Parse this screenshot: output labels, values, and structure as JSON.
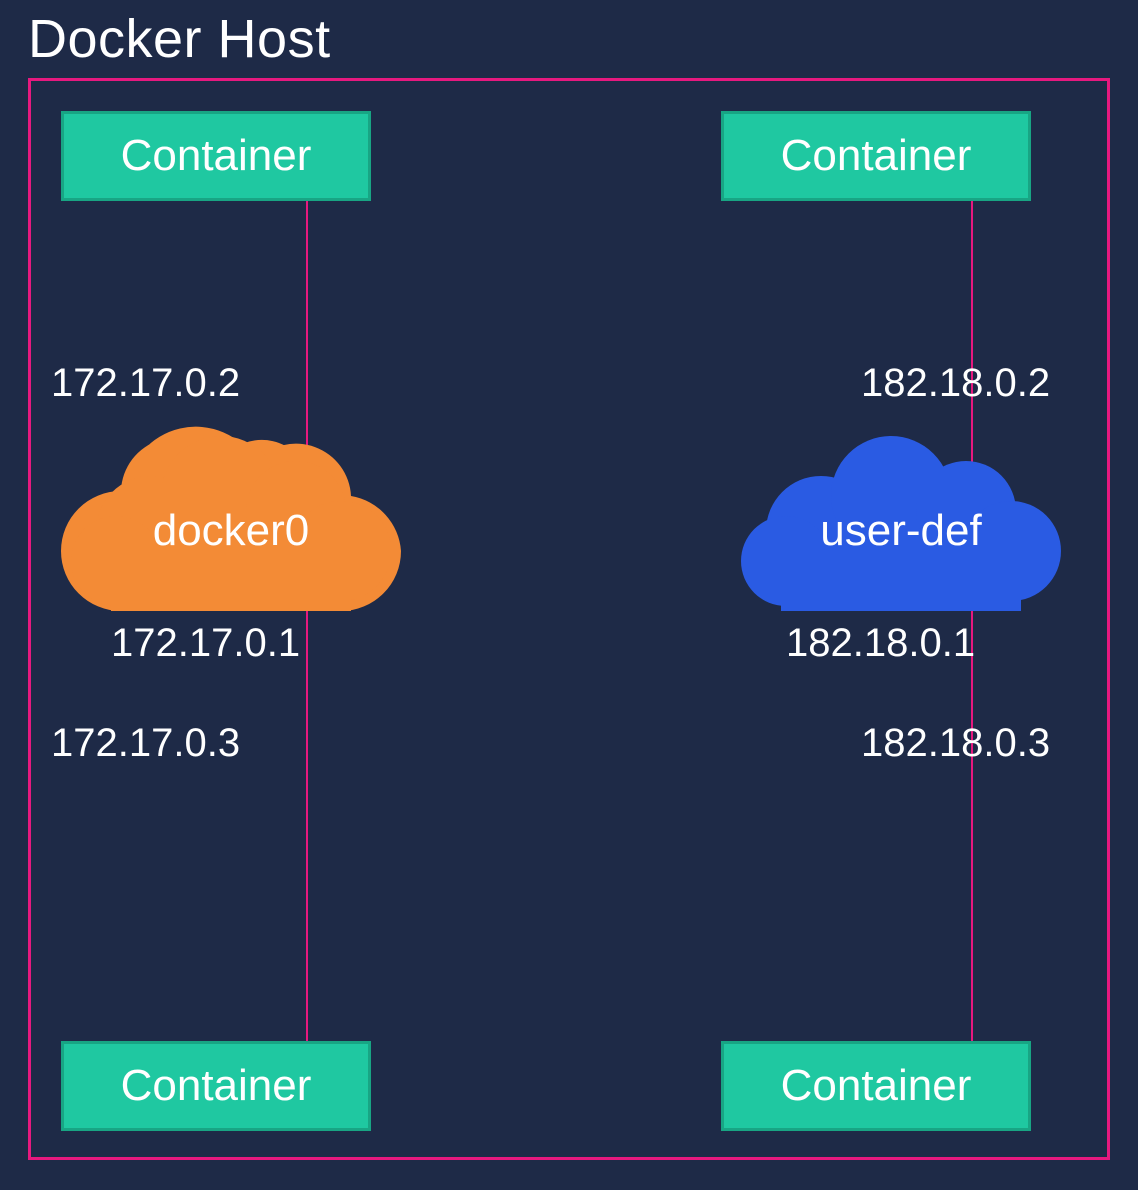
{
  "title": "Docker Host",
  "left": {
    "container_top": "Container",
    "container_bottom": "Container",
    "network_name": "docker0",
    "ip_top": "172.17.0.2",
    "ip_gateway": "172.17.0.1",
    "ip_bottom": "172.17.0.3",
    "cloud_color": "#f38b36"
  },
  "right": {
    "container_top": "Container",
    "container_bottom": "Container",
    "network_name": "user-def",
    "ip_top": "182.18.0.2",
    "ip_gateway": "182.18.0.1",
    "ip_bottom": "182.18.0.3",
    "cloud_color": "#2a5be3"
  },
  "colors": {
    "background": "#1e2a47",
    "border": "#e6197f",
    "container_fill": "#1fc8a1",
    "container_border": "#18a584"
  }
}
